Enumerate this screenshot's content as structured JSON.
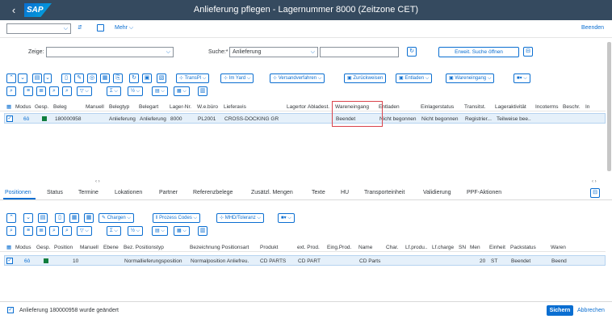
{
  "shell": {
    "title": "Anlieferung pflegen - Lagernummer 8000 (Zeitzone CET)",
    "back_icon": "‹",
    "logo": "SAP"
  },
  "toolbar2": {
    "more": "Mehr",
    "exit": "Beenden"
  },
  "search": {
    "show_label": "Zeige:",
    "search_label": "Suche:*",
    "search_value": "Anlieferung",
    "ext_search": "Erweit. Suche öffnen"
  },
  "toolbar3": {
    "transpl": "TransPl",
    "im_yard": "Im Yard",
    "versand": "Versandverfahren",
    "zurueck": "Zurückweisen",
    "entladen": "Entladen",
    "wareneingang": "Wareneingang"
  },
  "upper_grid": {
    "headers": [
      "Modus",
      "Gesp.",
      "Beleg",
      "Manuell",
      "Belegtyp",
      "Belegart",
      "Lager-Nr.",
      "W.e.büro",
      "Lieferavis",
      "Lagertor",
      "Abladest.",
      "Wareneingang",
      "Entladen",
      "Einlagerstatus",
      "Transitst.",
      "Lageraktivität",
      "Incoterms",
      "Beschr.",
      "In"
    ],
    "row": {
      "modus": "6ô",
      "beleg": "180000958",
      "belegtyp": "Anlieferung",
      "belegart": "Anlieferung",
      "lager": "8000",
      "webuero": "PL2001",
      "avis": "CROSS-DOCKING GR",
      "wareneingang": "Beendet",
      "entladen": "Nicht begonnen",
      "einlager": "Nicht begonnen",
      "transit": "Registrier...",
      "lageraktiv": "Teilweise bee.."
    }
  },
  "tabs": [
    "Positionen",
    "Status",
    "Termine",
    "Lokationen",
    "Partner",
    "Referenzbelege",
    "Zusätzl. Mengen",
    "Texte",
    "HU",
    "Transporteinheit",
    "Validierung",
    "PPF-Aktionen"
  ],
  "toolbar4": {
    "chargen": "Chargen",
    "prozess": "Prozess Codes",
    "mhd": "MHD/Toleranz"
  },
  "lower_grid": {
    "headers": [
      "Modus",
      "Gesp.",
      "Position",
      "Manuell",
      "Ebene",
      "Bez. Positionstyp",
      "Bezeichnung Positionsart",
      "Produkt",
      "ext. Prod.",
      "Eing.Prod.",
      "Name",
      "Char.",
      "Lf.produ..",
      "Lf.charge",
      "SN",
      "Men",
      "Einheit",
      "Packstatus",
      "Waren"
    ],
    "row": {
      "modus": "6ô",
      "position": "10",
      "positionstyp": "Normallieferungsposition",
      "positionsart": "Normalposition Anliefreu.",
      "produkt": "CD PARTS",
      "ext": "CD PART",
      "name": "CD Parts",
      "menge": "20",
      "einheit": "ST",
      "packstatus": "Beendet",
      "waren": "Beend"
    }
  },
  "footer": {
    "message": "Anlieferung 180000958 wurde geändert",
    "save": "Sichern",
    "cancel": "Abbrechen"
  },
  "colors": {
    "shell": "#354a5f",
    "accent": "#0a6ed1",
    "highlight": "#d9434b",
    "status_green": "#107e3e"
  }
}
